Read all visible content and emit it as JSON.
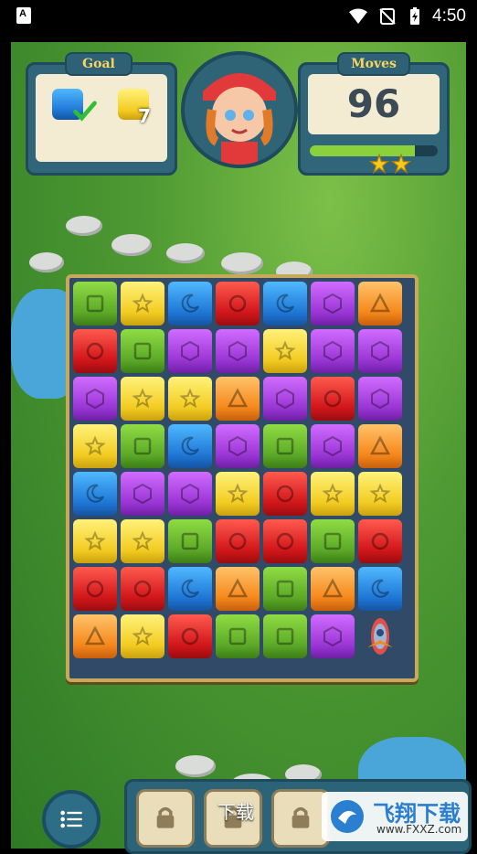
{
  "status_bar": {
    "time": "4:50",
    "app_badge": "A",
    "icons": [
      "wifi-icon",
      "no-sim-icon",
      "battery-charging-icon"
    ]
  },
  "hud": {
    "goal_label": "Goal",
    "moves_label": "Moves",
    "moves_value": "96",
    "goals": [
      {
        "color": "blue",
        "status": "completed"
      },
      {
        "color": "yellow",
        "remaining": "7"
      }
    ],
    "progress_fraction": 0.82,
    "stars_earned": 2
  },
  "board": {
    "rows": [
      [
        "green-square",
        "yellow-star",
        "blue-moon",
        "red-circle",
        "blue-moon",
        "purple-hex",
        "orange-triangle"
      ],
      [
        "red-circle",
        "green-square",
        "purple-hex",
        "purple-hex",
        "yellow-star",
        "purple-hex",
        "purple-hex"
      ],
      [
        "purple-hex",
        "yellow-star",
        "yellow-star",
        "orange-triangle",
        "purple-hex",
        "red-circle",
        "purple-hex"
      ],
      [
        "yellow-star",
        "green-square",
        "blue-moon",
        "purple-hex",
        "green-square",
        "purple-hex",
        "orange-triangle"
      ],
      [
        "blue-moon",
        "purple-hex",
        "purple-hex",
        "yellow-star",
        "red-circle",
        "yellow-star",
        "yellow-star"
      ],
      [
        "yellow-star",
        "yellow-star",
        "green-square",
        "red-circle",
        "red-circle",
        "green-square",
        "red-circle"
      ],
      [
        "red-circle",
        "red-circle",
        "blue-moon",
        "orange-triangle",
        "green-square",
        "orange-triangle",
        "blue-moon"
      ],
      [
        "orange-triangle",
        "yellow-star",
        "red-circle",
        "green-square",
        "green-square",
        "purple-hex",
        "rocket"
      ]
    ]
  },
  "bottom": {
    "download_label": "下载",
    "locked_slots": 3,
    "watermark_title": "飞翔下载",
    "watermark_url": "www.FXXZ.com"
  },
  "colors": {
    "red": "#d2161a",
    "green": "#5ca927",
    "blue": "#1f77d6",
    "yellow": "#f3cc22",
    "purple": "#9b36d6",
    "orange": "#f5881b",
    "board_frame": "#c7a95c",
    "hud_panel": "#30657a"
  }
}
